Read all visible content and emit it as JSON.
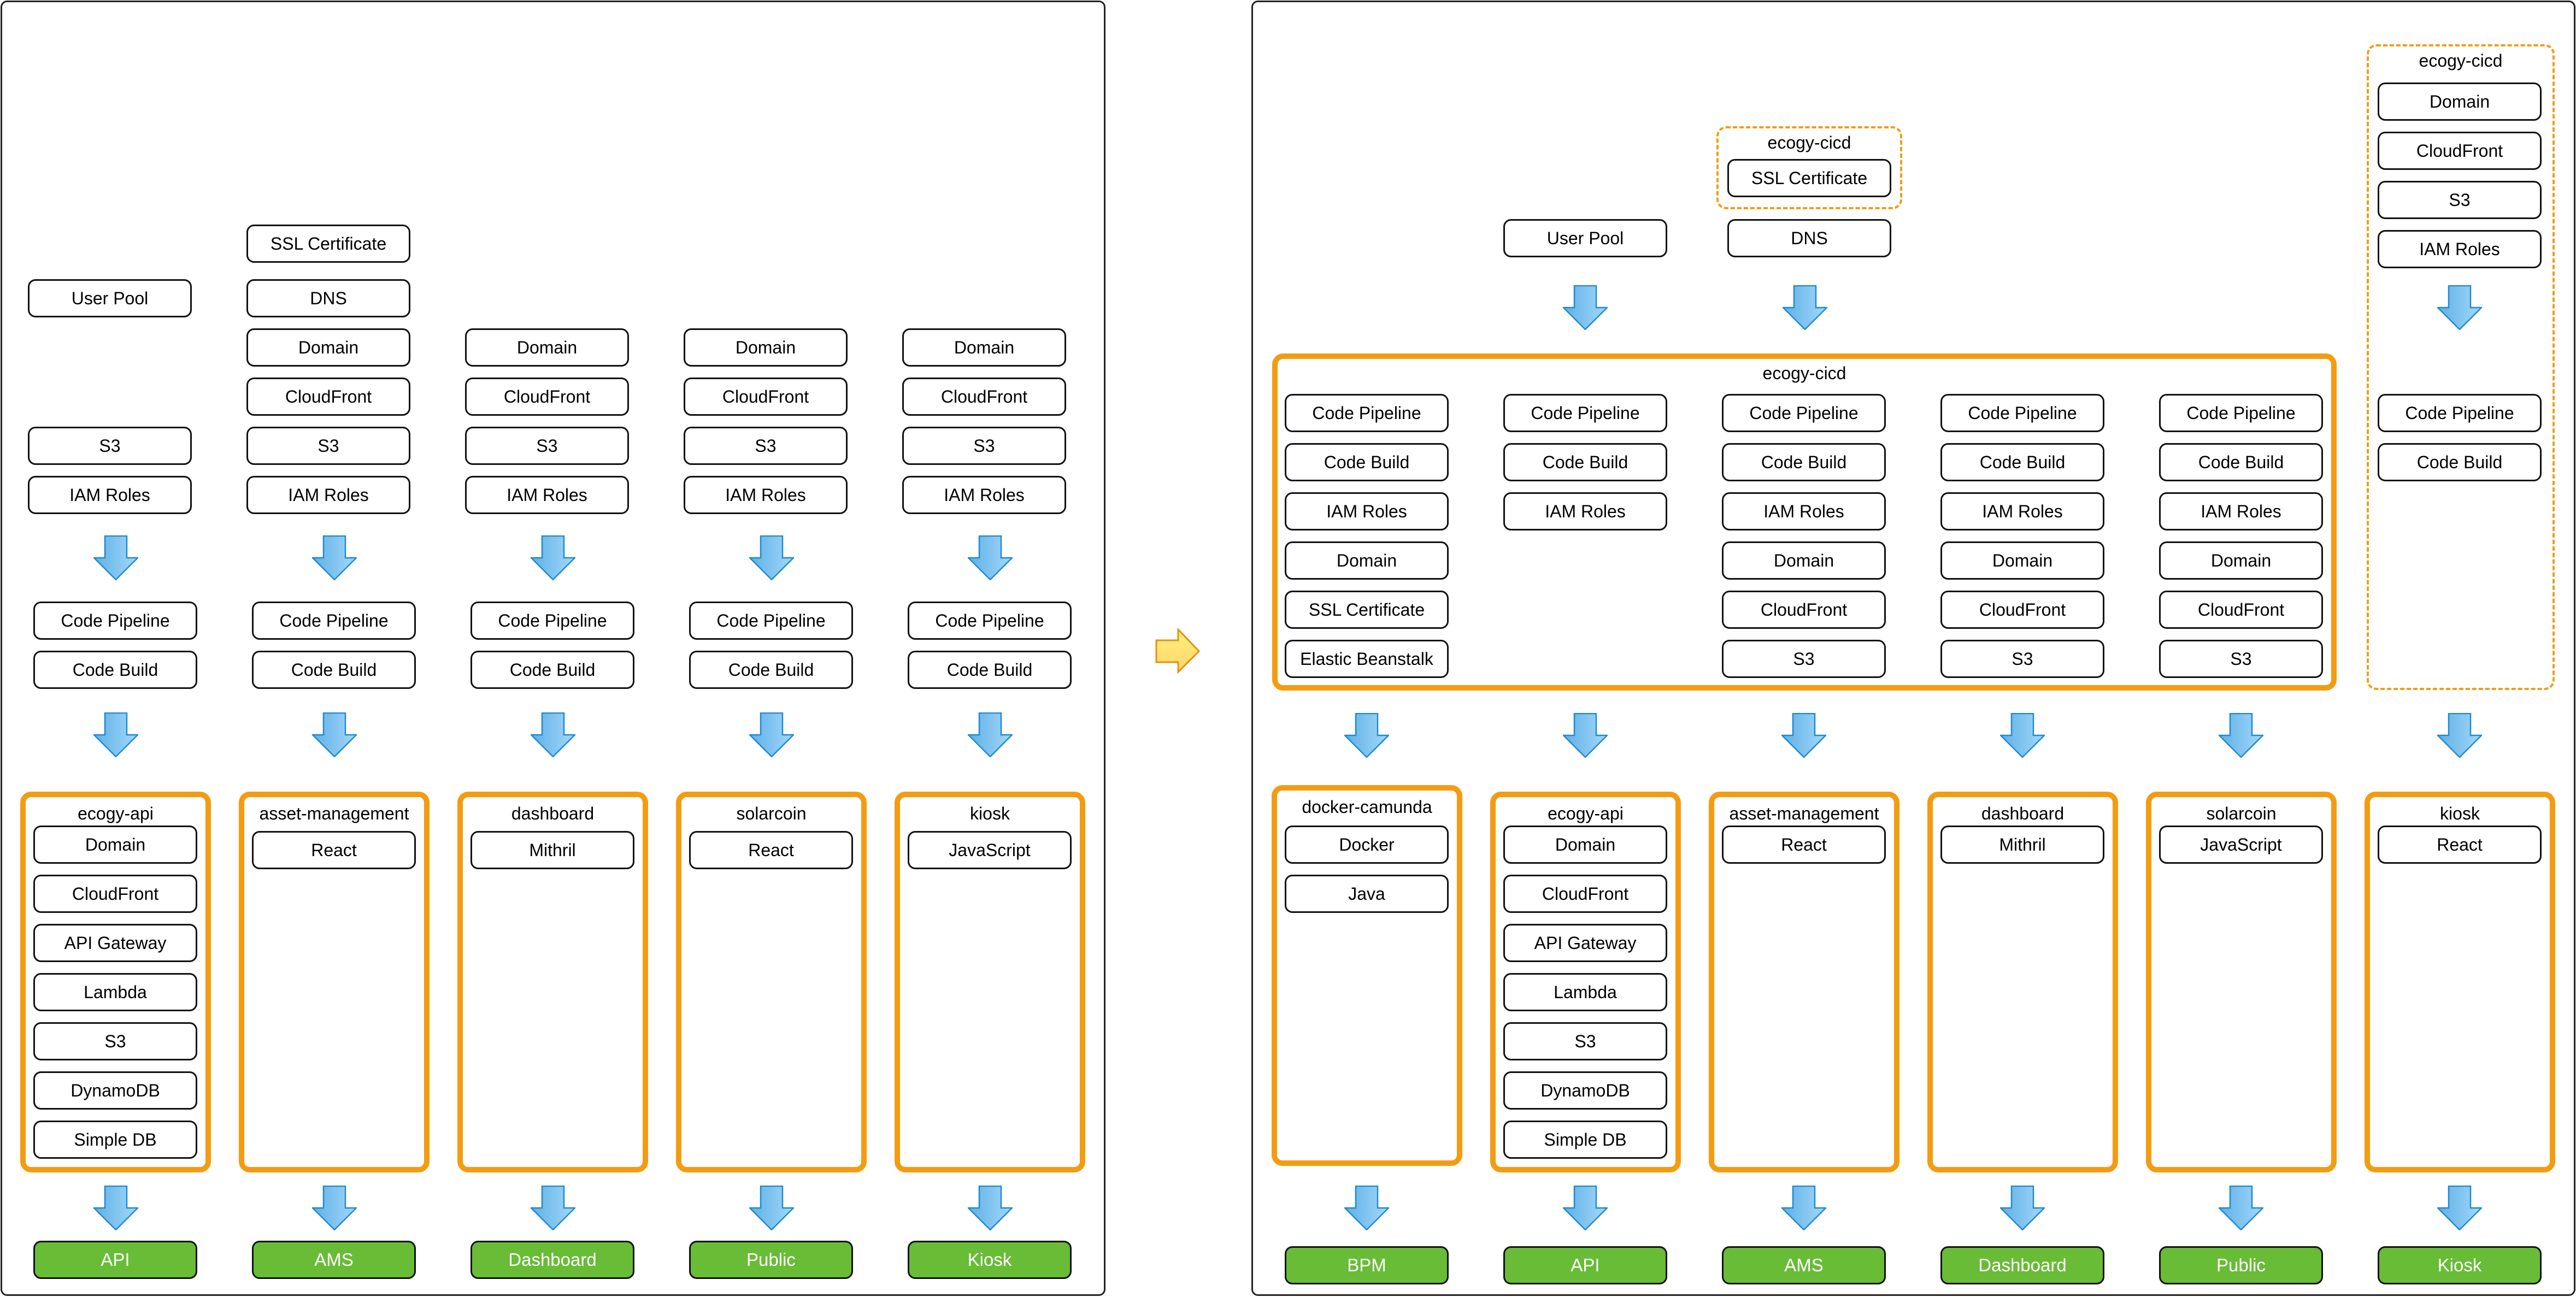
{
  "colors": {
    "container_border": "#f39c12",
    "output_fill": "#68bc36",
    "arrow_fill": "#7cc4ef",
    "arrow_stroke": "#1f8ad1",
    "transition_arrow_fill": "#ffe27a",
    "transition_arrow_stroke": "#e8900c"
  },
  "before": {
    "infra": [
      {
        "top": [
          "User Pool",
          "S3",
          "IAM Roles"
        ]
      },
      {
        "top": [
          "SSL Certificate",
          "DNS",
          "Domain",
          "CloudFront",
          "S3",
          "IAM Roles"
        ]
      },
      {
        "top": [
          "Domain",
          "CloudFront",
          "S3",
          "IAM Roles"
        ]
      },
      {
        "top": [
          "Domain",
          "CloudFront",
          "S3",
          "IAM Roles"
        ]
      },
      {
        "top": [
          "Domain",
          "CloudFront",
          "S3",
          "IAM Roles"
        ]
      }
    ],
    "cicd": [
      [
        "Code Pipeline",
        "Code Build"
      ],
      [
        "Code Pipeline",
        "Code Build"
      ],
      [
        "Code Pipeline",
        "Code Build"
      ],
      [
        "Code Pipeline",
        "Code Build"
      ],
      [
        "Code Pipeline",
        "Code Build"
      ]
    ],
    "repos": [
      {
        "name": "ecogy-api",
        "items": [
          "Domain",
          "CloudFront",
          "API Gateway",
          "Lambda",
          "S3",
          "DynamoDB",
          "Simple DB"
        ],
        "output": "API"
      },
      {
        "name": "asset-management",
        "items": [
          "React"
        ],
        "output": "AMS"
      },
      {
        "name": "dashboard",
        "items": [
          "Mithril"
        ],
        "output": "Dashboard"
      },
      {
        "name": "solarcoin",
        "items": [
          "React"
        ],
        "output": "Public"
      },
      {
        "name": "kiosk",
        "items": [
          "JavaScript"
        ],
        "output": "Kiosk"
      }
    ]
  },
  "after": {
    "user_pool": "User Pool",
    "ssl_group": {
      "title": "ecogy-cicd",
      "items": [
        "SSL Certificate"
      ]
    },
    "dns": "DNS",
    "kiosk_group": {
      "title": "ecogy-cicd",
      "items": [
        "Domain",
        "CloudFront",
        "S3",
        "IAM Roles"
      ],
      "cicd": [
        "Code Pipeline",
        "Code Build"
      ]
    },
    "cicd_group": {
      "title": "ecogy-cicd",
      "columns": [
        [
          "Code Pipeline",
          "Code Build",
          "IAM Roles",
          "Domain",
          "SSL Certificate",
          "Elastic Beanstalk"
        ],
        [
          "Code Pipeline",
          "Code Build",
          "IAM Roles"
        ],
        [
          "Code Pipeline",
          "Code Build",
          "IAM Roles",
          "Domain",
          "CloudFront",
          "S3"
        ],
        [
          "Code Pipeline",
          "Code Build",
          "IAM Roles",
          "Domain",
          "CloudFront",
          "S3"
        ],
        [
          "Code Pipeline",
          "Code Build",
          "IAM Roles",
          "Domain",
          "CloudFront",
          "S3"
        ]
      ]
    },
    "repos": [
      {
        "name": "docker-camunda",
        "items": [
          "Docker",
          "Java"
        ],
        "output": "BPM"
      },
      {
        "name": "ecogy-api",
        "items": [
          "Domain",
          "CloudFront",
          "API Gateway",
          "Lambda",
          "S3",
          "DynamoDB",
          "Simple DB"
        ],
        "output": "API"
      },
      {
        "name": "asset-management",
        "items": [
          "React"
        ],
        "output": "AMS"
      },
      {
        "name": "dashboard",
        "items": [
          "Mithril"
        ],
        "output": "Dashboard"
      },
      {
        "name": "solarcoin",
        "items": [
          "JavaScript"
        ],
        "output": "Public"
      },
      {
        "name": "kiosk",
        "items": [
          "React"
        ],
        "output": "Kiosk"
      }
    ]
  }
}
